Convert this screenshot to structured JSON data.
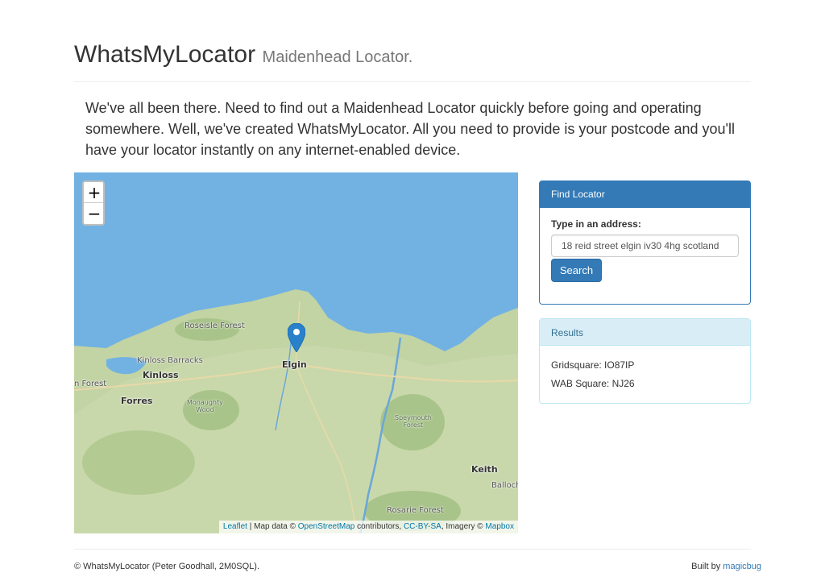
{
  "header": {
    "title": "WhatsMyLocator",
    "subtitle": "Maidenhead Locator."
  },
  "intro": {
    "text": "We've all been there. Need to find out a Maidenhead Locator quickly before going and operating somewhere. Well, we've created WhatsMyLocator. All you need to provide is your postcode and you'll have your locator instantly on any internet-enabled device."
  },
  "map": {
    "zoom_in_label": "+",
    "zoom_out_label": "−",
    "labels": {
      "roseisle": "Roseisle Forest",
      "kinloss_barracks": "Kinloss Barracks",
      "kinloss": "Kinloss",
      "forest_left": "n Forest",
      "forres": "Forres",
      "monaughty": "Monaughty",
      "wood": "Wood",
      "elgin": "Elgin",
      "speymouth": "Speymouth",
      "forest": "Forest",
      "keith": "Keith",
      "balloch": "Balloch",
      "rosarie": "Rosarie Forest"
    },
    "attribution": {
      "leaflet": "Leaflet",
      "sep1": " | Map data © ",
      "osm": "OpenStreetMap",
      "contributors": " contributors, ",
      "license": "CC-BY-SA",
      "imagery": ", Imagery © ",
      "mapbox": "Mapbox"
    },
    "colors": {
      "sea": "#71b2e2",
      "land": "#c2d3a4",
      "marker": "#2a81cb"
    }
  },
  "find_panel": {
    "heading": "Find Locator",
    "field_label": "Type in an address:",
    "input_value": "18 reid street elgin iv30 4hg scotland",
    "button_label": "Search"
  },
  "results_panel": {
    "heading": "Results",
    "gridsquare_label": "Gridsquare: ",
    "gridsquare_value": "IO87IP",
    "wab_label": "WAB Square: ",
    "wab_value": "NJ26"
  },
  "footer": {
    "copyright": "© WhatsMyLocator (Peter Goodhall, 2M0SQL).",
    "built_by_label": "Built by ",
    "built_by_link": "magicbug"
  }
}
